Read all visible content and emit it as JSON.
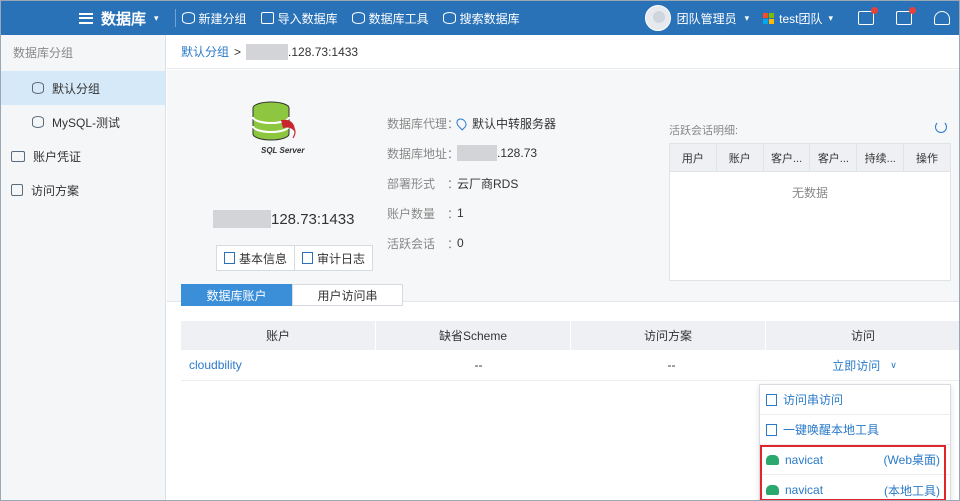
{
  "topbar": {
    "title": "数据库",
    "tools": [
      {
        "label": "新建分组",
        "icon": "add-group-icon"
      },
      {
        "label": "导入数据库",
        "icon": "import-icon"
      },
      {
        "label": "数据库工具",
        "icon": "database-tool-icon"
      },
      {
        "label": "搜索数据库",
        "icon": "search-database-icon"
      }
    ],
    "role": "团队管理员",
    "team": "test团队",
    "colors": {
      "bar": "#2a72b8",
      "accent": "#2a7ac8",
      "notify": "#e8413a"
    }
  },
  "sidebar": {
    "section": "数据库分组",
    "groups": [
      "默认分组",
      "MySQL-测试"
    ],
    "items": [
      "账户凭证",
      "访问方案"
    ]
  },
  "breadcrumb": {
    "root": "默认分组",
    "sep": ">",
    "host": ".128.73:1433"
  },
  "db": {
    "name": "128.73:1433",
    "logo_text": "SQL Server",
    "buttons": [
      "基本信息",
      "审计日志"
    ],
    "fields": [
      {
        "key": "数据库代理",
        "value": "默认中转服务器"
      },
      {
        "key": "数据库地址",
        "value": ".128.73"
      },
      {
        "key": "部署形式",
        "value": "云厂商RDS"
      },
      {
        "key": "账户数量",
        "value": "1"
      },
      {
        "key": "活跃会话",
        "value": "0"
      }
    ],
    "colon": "："
  },
  "sessions": {
    "title": "活跃会话明细:",
    "columns": [
      "用户",
      "账户",
      "客户...",
      "客户...",
      "持续...",
      "操作"
    ],
    "empty": "无数据"
  },
  "tabs": [
    "数据库账户",
    "用户访问串"
  ],
  "accounts": {
    "columns": [
      "账户",
      "缺省Scheme",
      "访问方案",
      "访问"
    ],
    "rows": [
      {
        "account": "cloudbility",
        "scheme": "--",
        "plan": "--",
        "visit": "立即访问"
      }
    ]
  },
  "menu": {
    "items": [
      {
        "label": "访问串访问",
        "suffix": ""
      },
      {
        "label": "一键唤醒本地工具",
        "suffix": ""
      },
      {
        "label": "navicat",
        "suffix": "(Web桌面)"
      },
      {
        "label": "navicat",
        "suffix": "(本地工具)"
      }
    ],
    "highlight_color": "#e0262b"
  }
}
